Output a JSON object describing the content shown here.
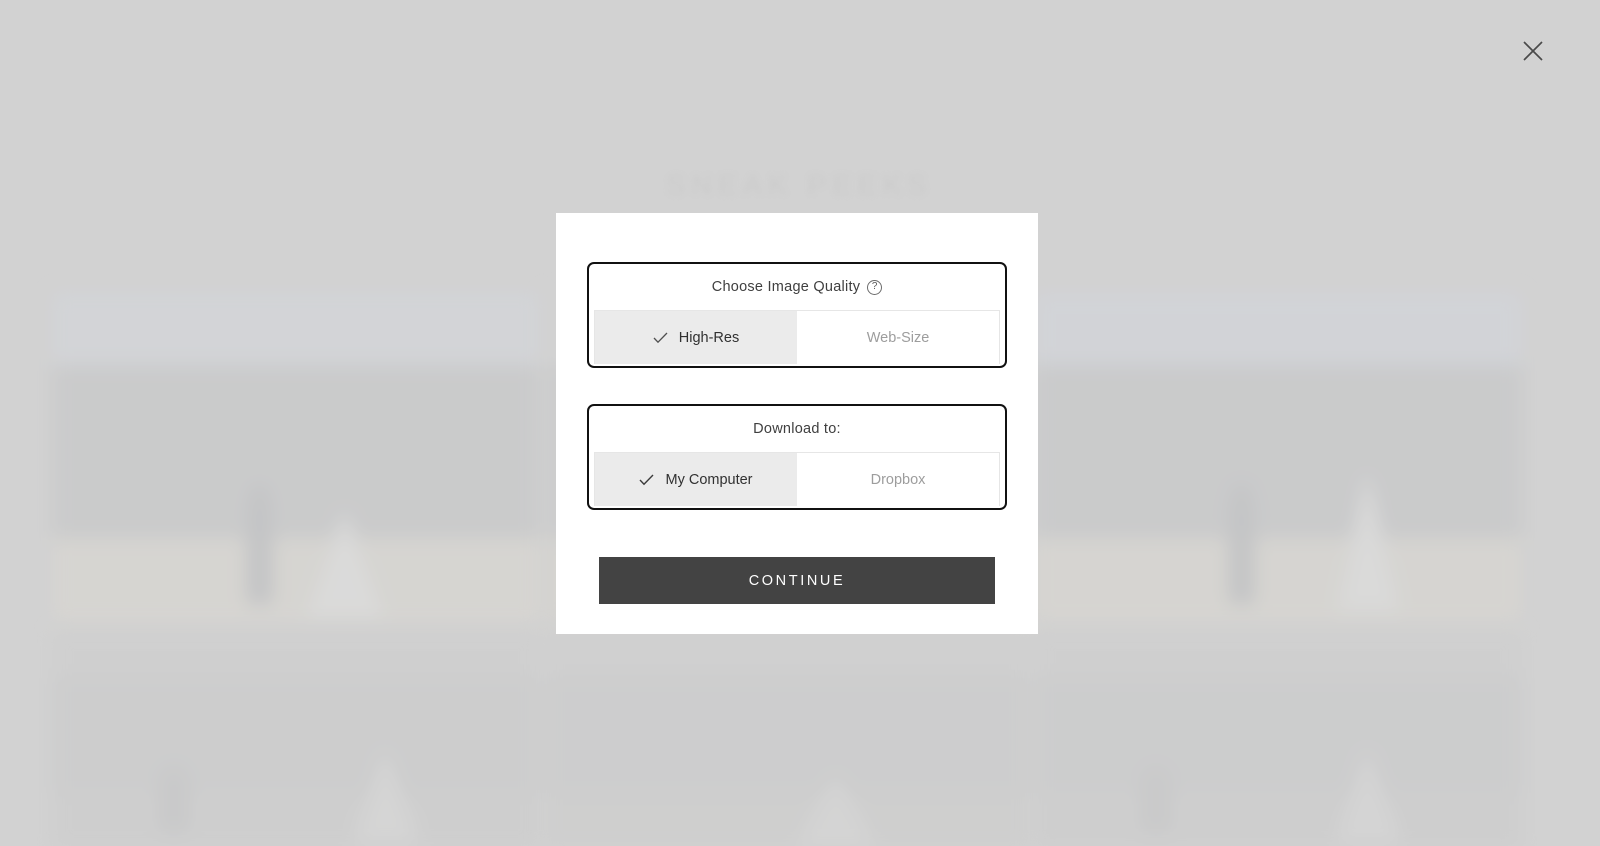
{
  "background": {
    "heading": "SNEAK PEEKS",
    "page_background_color": "#c3c3c3",
    "gallery": {
      "columns": 3,
      "tiles": [
        {
          "name": "photo-tile-1",
          "sky": "#c8cdd8",
          "mountain": "#a9abad",
          "ground": "#d4cfc2"
        },
        {
          "name": "photo-tile-2",
          "sky": "#c6c6c6",
          "mountain": "#b0b1b2",
          "ground": "#cfcabe"
        },
        {
          "name": "photo-tile-3",
          "sky": "#c4cbd9",
          "mountain": "#a8aaad",
          "ground": "#d3cec1"
        },
        {
          "name": "photo-tile-4",
          "sky": "#bcbcbc",
          "mountain": "#b2b3b4",
          "ground": "#b9b9b9"
        },
        {
          "name": "photo-tile-5",
          "sky": "#bdbdbd",
          "mountain": "#b3b4b5",
          "ground": "#babab9"
        },
        {
          "name": "photo-tile-6",
          "sky": "#bcbcbc",
          "mountain": "#b1b2b4",
          "ground": "#b8b8b8"
        }
      ]
    }
  },
  "modal": {
    "close_label": "Close",
    "close_icon": "close-x-icon",
    "quality_group": {
      "title": "Choose Image Quality",
      "help_icon": "question-mark-icon",
      "help_glyph": "?",
      "options": [
        {
          "label": "High-Res",
          "selected": true,
          "check_icon": "checkmark-icon"
        },
        {
          "label": "Web-Size",
          "selected": false,
          "check_icon": "checkmark-icon"
        }
      ]
    },
    "destination_group": {
      "title": "Download to:",
      "options": [
        {
          "label": "My Computer",
          "selected": true,
          "check_icon": "checkmark-icon"
        },
        {
          "label": "Dropbox",
          "selected": false,
          "check_icon": "checkmark-icon"
        }
      ]
    },
    "continue_label": "CONTINUE"
  },
  "colors": {
    "selected_segment": "#ebebeb",
    "unselected_text": "#9d9d9d",
    "primary_button": "#434343",
    "group_border": "#111111"
  }
}
